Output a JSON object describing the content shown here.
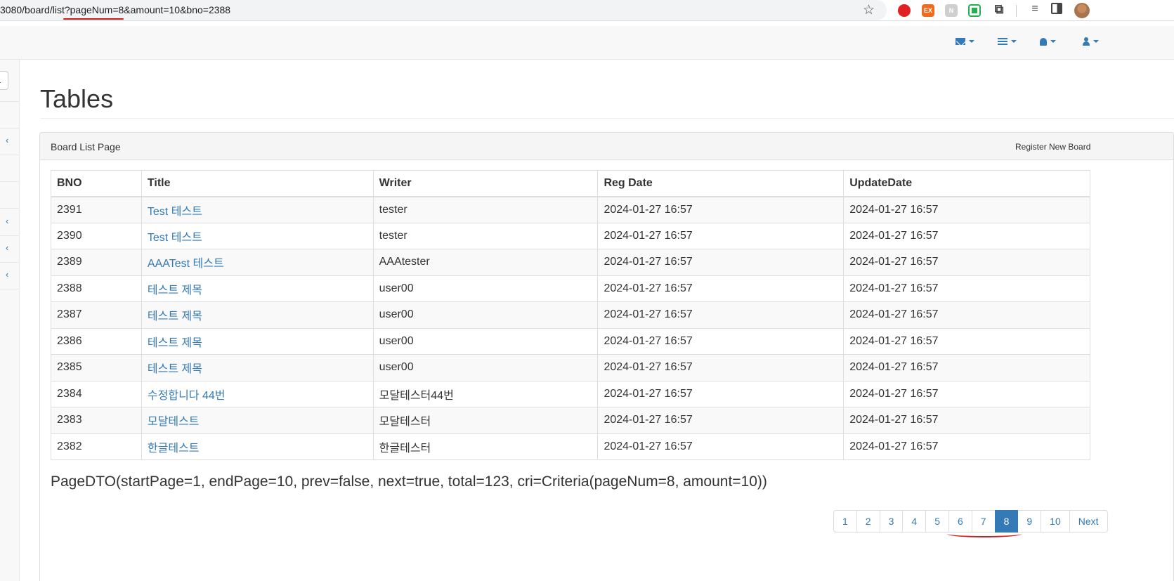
{
  "browser": {
    "url": "3080/board/list?pageNum=8&amount=10&bno=2388",
    "extensions": [
      "adblock-icon",
      "ex-icon",
      "notion-icon",
      "screen-icon",
      "puzzle-icon",
      "queue-icon",
      "sidepanel-icon",
      "profile-avatar"
    ],
    "ext_ex_label": "EX",
    "ext_n_label": "N"
  },
  "page": {
    "title": "Tables"
  },
  "panel": {
    "heading": "Board List Page",
    "register_label": "Register New Board"
  },
  "table": {
    "headers": [
      "BNO",
      "Title",
      "Writer",
      "Reg Date",
      "UpdateDate"
    ],
    "rows": [
      {
        "bno": "2391",
        "title": "Test 테스트",
        "writer": "tester",
        "reg": "2024-01-27 16:57",
        "upd": "2024-01-27 16:57"
      },
      {
        "bno": "2390",
        "title": "Test 테스트",
        "writer": "tester",
        "reg": "2024-01-27 16:57",
        "upd": "2024-01-27 16:57"
      },
      {
        "bno": "2389",
        "title": "AAATest 테스트",
        "writer": "AAAtester",
        "reg": "2024-01-27 16:57",
        "upd": "2024-01-27 16:57"
      },
      {
        "bno": "2388",
        "title": "테스트 제목",
        "writer": "user00",
        "reg": "2024-01-27 16:57",
        "upd": "2024-01-27 16:57"
      },
      {
        "bno": "2387",
        "title": "테스트 제목",
        "writer": "user00",
        "reg": "2024-01-27 16:57",
        "upd": "2024-01-27 16:57"
      },
      {
        "bno": "2386",
        "title": "테스트 제목",
        "writer": "user00",
        "reg": "2024-01-27 16:57",
        "upd": "2024-01-27 16:57"
      },
      {
        "bno": "2385",
        "title": "테스트 제목",
        "writer": "user00",
        "reg": "2024-01-27 16:57",
        "upd": "2024-01-27 16:57"
      },
      {
        "bno": "2384",
        "title": "수정합니다 44번",
        "writer": "모달테스터44번",
        "reg": "2024-01-27 16:57",
        "upd": "2024-01-27 16:57"
      },
      {
        "bno": "2383",
        "title": "모달테스트",
        "writer": "모달테스터",
        "reg": "2024-01-27 16:57",
        "upd": "2024-01-27 16:57"
      },
      {
        "bno": "2382",
        "title": "한글테스트",
        "writer": "한글테스터",
        "reg": "2024-01-27 16:57",
        "upd": "2024-01-27 16:57"
      }
    ]
  },
  "pagedto_text": "PageDTO(startPage=1, endPage=10, prev=false, next=true, total=123, cri=Criteria(pageNum=8, amount=10))",
  "pagination": {
    "pages": [
      "1",
      "2",
      "3",
      "4",
      "5",
      "6",
      "7",
      "8",
      "9",
      "10"
    ],
    "active": "8",
    "next_label": "Next"
  },
  "colors": {
    "link": "#337ab7",
    "annotation_red": "#d31a1a"
  }
}
